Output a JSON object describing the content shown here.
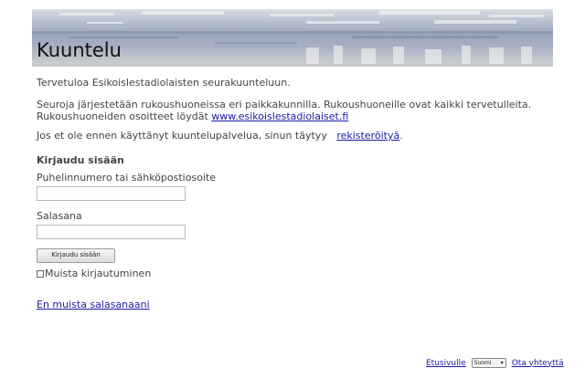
{
  "banner": {
    "title": "Kuuntelu"
  },
  "intro": {
    "text": "Tervetuloa Esikoislestadiolaisten seurakuunteluun."
  },
  "services": {
    "line1": "Seuroja järjestetään rukoushuoneissa eri paikkakunnilla. Rukoushuoneille ovat kaikki tervetulleita.",
    "line2_prefix": "Rukoushuoneiden osoitteet löydät ",
    "link": "www.esikoislestadiolaiset.fi"
  },
  "register": {
    "prefix": "Jos et ole ennen käyttänyt kuuntelupalvelua, sinun täytyy ",
    "link": "rekisteröityä",
    "suffix": "."
  },
  "login": {
    "heading": "Kirjaudu sisään",
    "username_label": "Puhelinnumero tai sähköpostiosoite",
    "username_value": "",
    "password_label": "Salasana",
    "password_value": "",
    "submit_label": "Kirjaudu sisään",
    "remember_label": "Muista kirjautuminen",
    "forgot_link": "En muista salasanaani"
  },
  "footer": {
    "home_link": "Etusivulle",
    "language_selected": "Suomi",
    "contact_link": "Ota yhteyttä"
  }
}
